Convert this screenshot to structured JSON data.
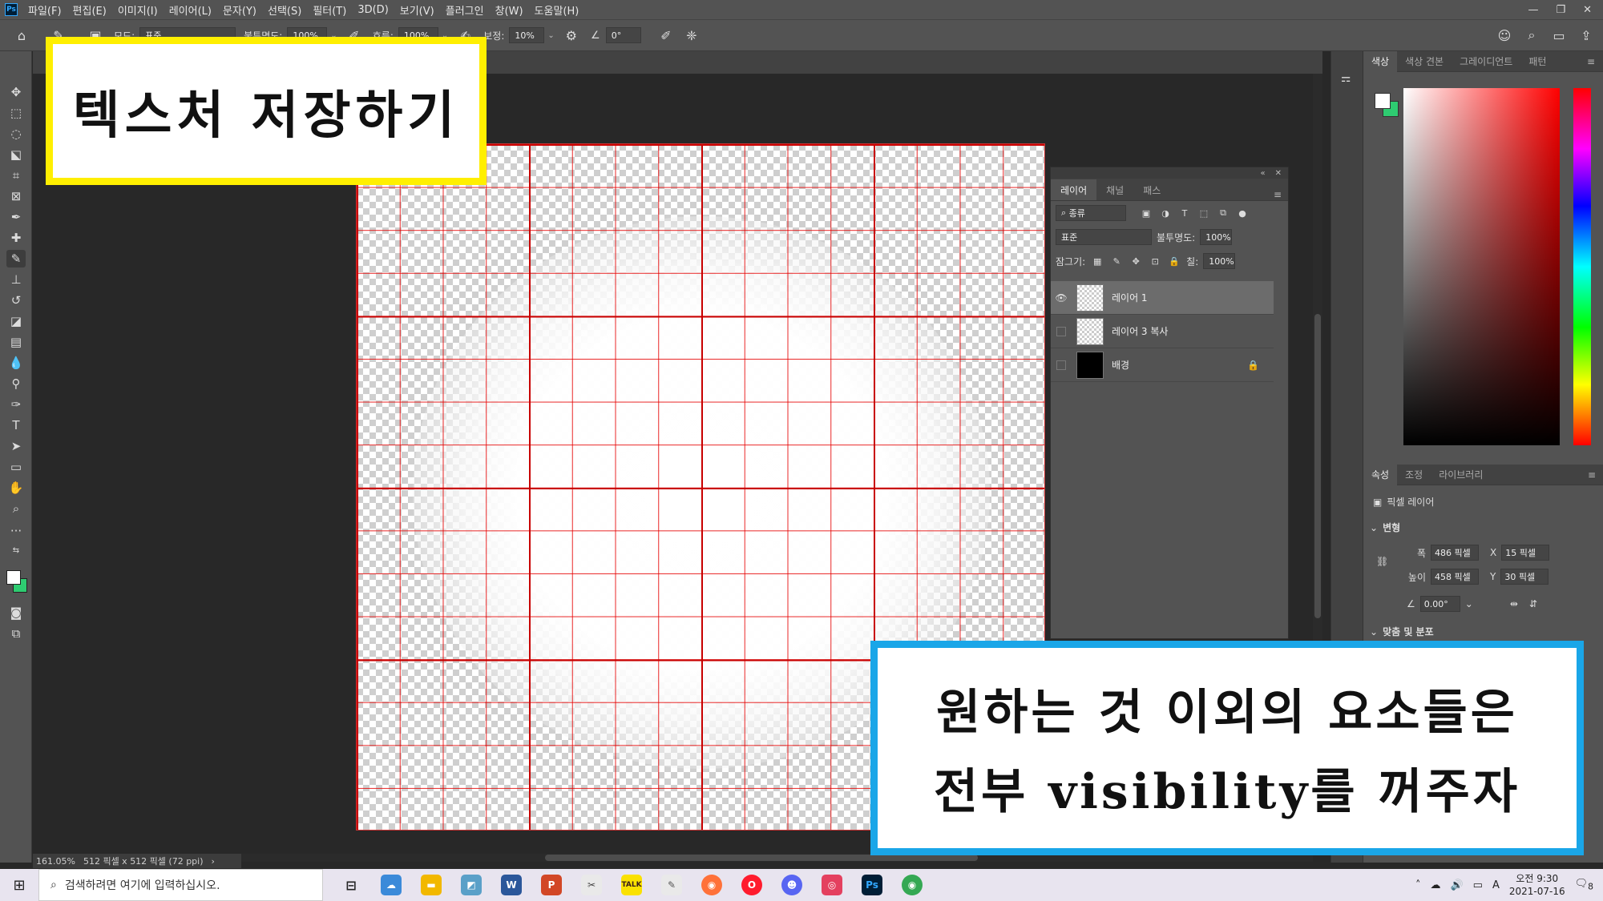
{
  "menubar": {
    "logo": "Ps",
    "items": [
      "파일(F)",
      "편집(E)",
      "이미지(I)",
      "레이어(L)",
      "문자(Y)",
      "선택(S)",
      "필터(T)",
      "3D(D)",
      "보기(V)",
      "플러그인",
      "창(W)",
      "도움말(H)"
    ]
  },
  "options": {
    "mode_label": "모드:",
    "mode_value": "표준",
    "opacity_label": "불투명도:",
    "opacity_value": "100%",
    "flow_label": "흐름:",
    "flow_value": "100%",
    "smoothing_label": "보정:",
    "smoothing_value": "10%",
    "angle_value": "0°"
  },
  "layers_panel": {
    "tabs": [
      "레이어",
      "채널",
      "패스"
    ],
    "filter_value": "종류",
    "blend_value": "표준",
    "opacity_label": "불투명도:",
    "opacity_value": "100%",
    "lock_label": "잠그기:",
    "fill_label": "칠:",
    "fill_value": "100%",
    "layers": [
      {
        "name": "레이어 1",
        "visible": true,
        "selected": true
      },
      {
        "name": "레이어 3 복사",
        "visible": false,
        "selected": false
      },
      {
        "name": "배경",
        "visible": false,
        "selected": false,
        "locked": true
      }
    ]
  },
  "color_panel": {
    "tabs": [
      "색상",
      "색상 견본",
      "그레이디언트",
      "패턴"
    ],
    "foreground": "#ffffff",
    "background": "#2ecc71"
  },
  "properties_panel": {
    "tabs": [
      "속성",
      "조정",
      "라이브러리"
    ],
    "layer_type": "픽셀 레이어",
    "section_transform": "변형",
    "width_label": "폭",
    "width_value": "486 픽셀",
    "x_label": "X",
    "x_value": "15 픽셀",
    "height_label": "높이",
    "height_value": "458 픽셀",
    "y_label": "Y",
    "y_value": "30 픽셀",
    "angle_value": "0.00°",
    "section_align": "맞춤 및 분포"
  },
  "status": {
    "zoom": "161.05%",
    "doc_size": "512 픽셀 x 512 픽셀 (72 ppi)"
  },
  "callouts": {
    "top": "텍스처 저장하기",
    "bottom_line1": "원하는 것 이외의 요소들은",
    "bottom_line2": "전부 visibility를 꺼주자"
  },
  "taskbar": {
    "search_placeholder": "검색하려면 여기에 입력하십시오.",
    "time": "오전 9:30",
    "date": "2021-07-16",
    "ime": "A",
    "notif_count": "8"
  }
}
